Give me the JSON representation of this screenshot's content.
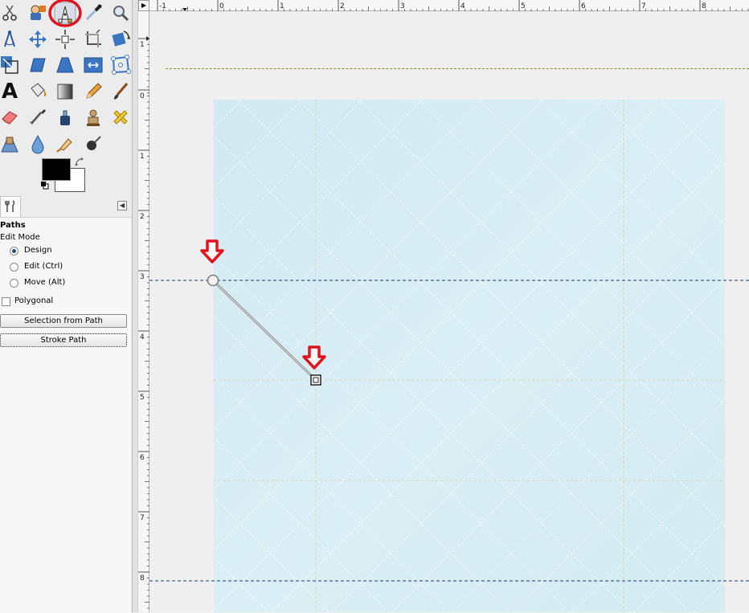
{
  "toolbox": {
    "tools": [
      {
        "name": "scissors-select-tool-icon"
      },
      {
        "name": "foreground-select-tool-icon"
      },
      {
        "name": "paths-tool-icon",
        "active": true,
        "highlighted": true
      },
      {
        "name": "color-picker-tool-icon"
      },
      {
        "name": "zoom-tool-icon"
      },
      {
        "name": "measure-tool-icon"
      },
      {
        "name": "move-tool-icon"
      },
      {
        "name": "alignment-tool-icon"
      },
      {
        "name": "crop-tool-icon"
      },
      {
        "name": "rotate-tool-icon"
      },
      {
        "name": "scale-tool-icon"
      },
      {
        "name": "shear-tool-icon"
      },
      {
        "name": "perspective-tool-icon"
      },
      {
        "name": "flip-tool-icon"
      },
      {
        "name": "cage-transform-tool-icon"
      },
      {
        "name": "text-tool-icon",
        "glyph": "A"
      },
      {
        "name": "bucket-fill-tool-icon"
      },
      {
        "name": "blend-tool-icon"
      },
      {
        "name": "pencil-tool-icon"
      },
      {
        "name": "paintbrush-tool-icon"
      },
      {
        "name": "eraser-tool-icon"
      },
      {
        "name": "airbrush-tool-icon"
      },
      {
        "name": "ink-tool-icon"
      },
      {
        "name": "clone-tool-icon"
      },
      {
        "name": "heal-tool-icon"
      },
      {
        "name": "perspective-clone-tool-icon"
      },
      {
        "name": "blur-sharpen-tool-icon"
      },
      {
        "name": "smudge-tool-icon"
      },
      {
        "name": "dodge-burn-tool-icon"
      }
    ],
    "foreground_color": "#000000",
    "background_color": "#ffffff",
    "highlight_color": "#e0141e"
  },
  "tool_options": {
    "title": "Paths",
    "edit_mode_label": "Edit Mode",
    "modes": [
      {
        "label": "Design",
        "selected": true
      },
      {
        "label": "Edit (Ctrl)",
        "selected": false
      },
      {
        "label": "Move (Alt)",
        "selected": false
      }
    ],
    "polygonal_label": "Polygonal",
    "polygonal_checked": false,
    "selection_from_path_label": "Selection from Path",
    "stroke_path_label": "Stroke Path"
  },
  "rulers": {
    "horizontal_labels": [
      "-1",
      "0",
      "1",
      "2",
      "3",
      "4",
      "5",
      "6",
      "7",
      "8"
    ],
    "vertical_labels": [
      "1",
      "0",
      "1",
      "2",
      "3",
      "4",
      "5",
      "6",
      "7",
      "8"
    ]
  },
  "canvas": {
    "image_color": "#d7ecf3",
    "guide_color": "#1a3b6e",
    "annotation_arrow_color": "#e0141e"
  }
}
